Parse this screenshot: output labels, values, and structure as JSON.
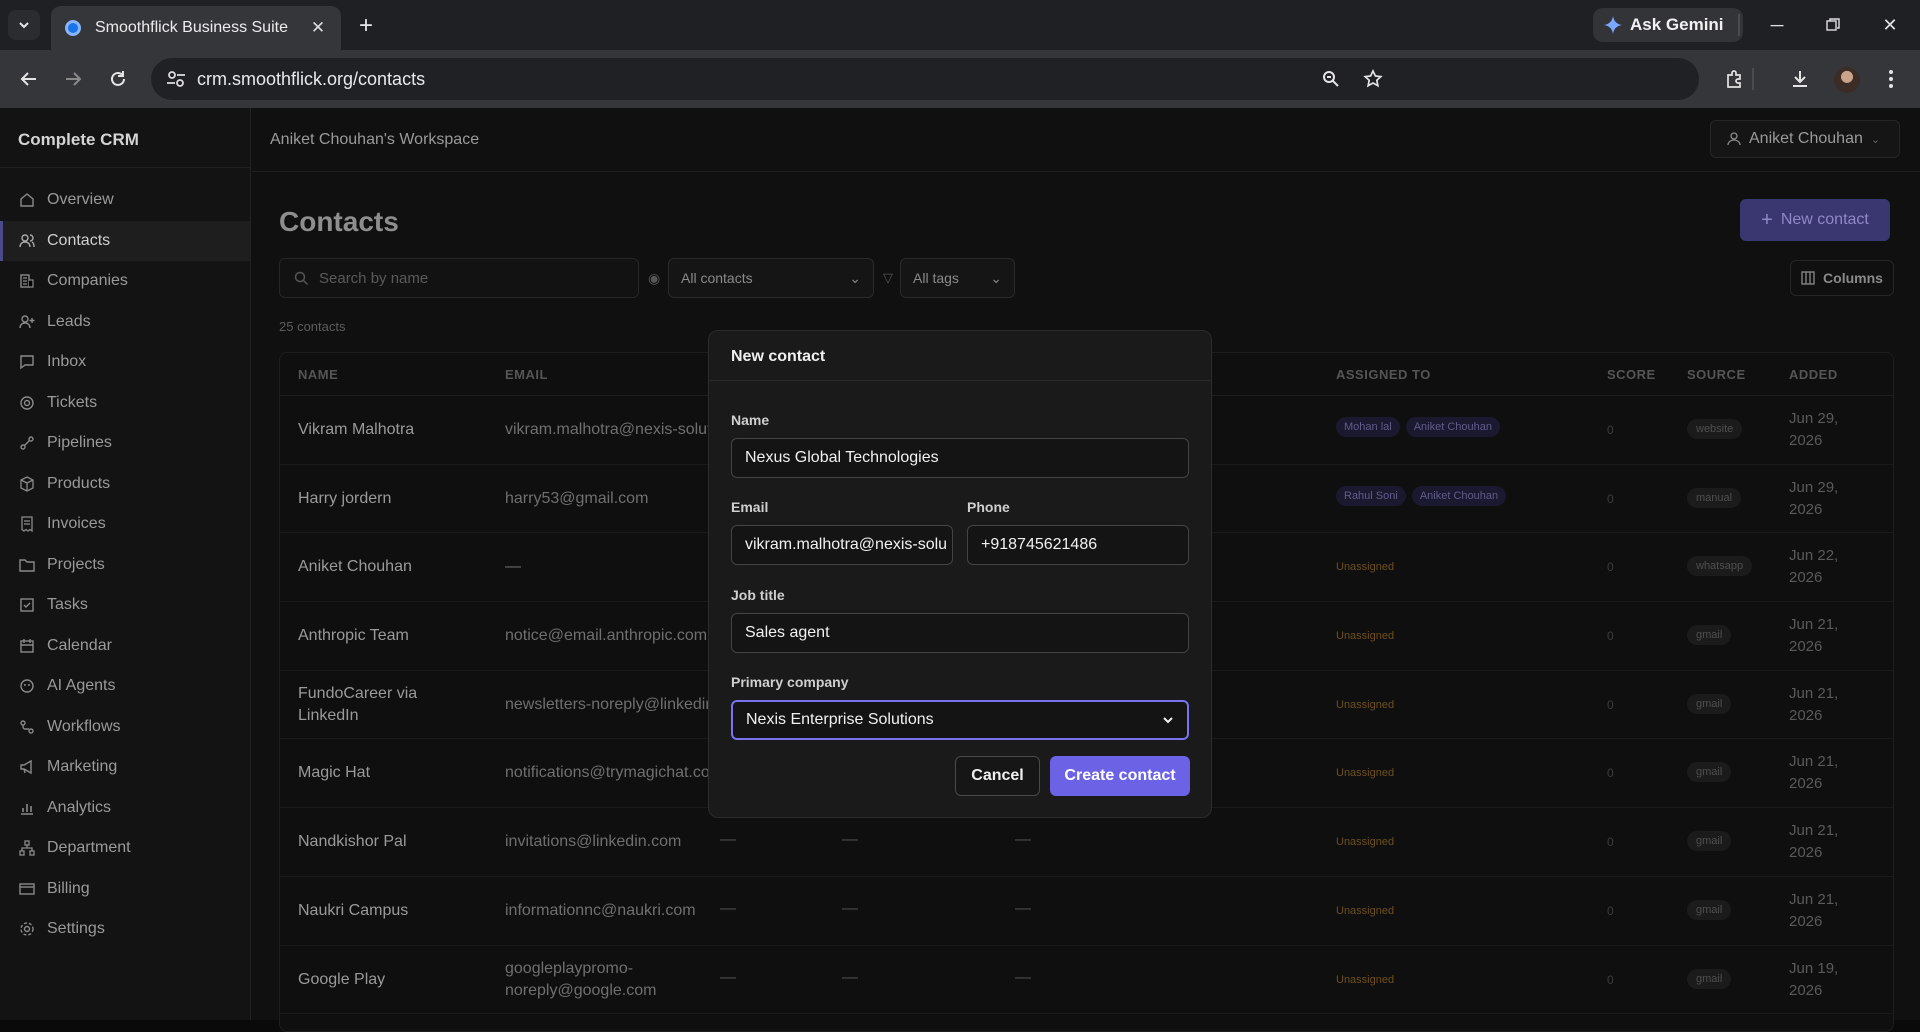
{
  "browser": {
    "tab_title": "Smoothflick Business Suite",
    "url": "crm.smoothflick.org/contacts",
    "gemini_label": "Ask Gemini"
  },
  "sidebar": {
    "brand": "Complete CRM",
    "items": [
      {
        "label": "Overview",
        "icon": "home-icon"
      },
      {
        "label": "Contacts",
        "icon": "users-icon",
        "active": true
      },
      {
        "label": "Companies",
        "icon": "building-icon"
      },
      {
        "label": "Leads",
        "icon": "user-plus-icon"
      },
      {
        "label": "Inbox",
        "icon": "message-icon"
      },
      {
        "label": "Tickets",
        "icon": "lifebuoy-icon"
      },
      {
        "label": "Pipelines",
        "icon": "pipeline-icon"
      },
      {
        "label": "Products",
        "icon": "package-icon"
      },
      {
        "label": "Invoices",
        "icon": "receipt-icon"
      },
      {
        "label": "Projects",
        "icon": "folder-icon"
      },
      {
        "label": "Tasks",
        "icon": "checkbox-icon"
      },
      {
        "label": "Calendar",
        "icon": "calendar-icon"
      },
      {
        "label": "AI Agents",
        "icon": "bot-icon"
      },
      {
        "label": "Workflows",
        "icon": "workflow-icon"
      },
      {
        "label": "Marketing",
        "icon": "megaphone-icon"
      },
      {
        "label": "Analytics",
        "icon": "bar-chart-icon"
      },
      {
        "label": "Department",
        "icon": "network-icon"
      },
      {
        "label": "Billing",
        "icon": "credit-card-icon"
      },
      {
        "label": "Settings",
        "icon": "gear-icon"
      }
    ]
  },
  "header": {
    "workspace": "Aniket Chouhan's Workspace",
    "user": "Aniket Chouhan"
  },
  "contacts": {
    "title": "Contacts",
    "new_button": "New contact",
    "search_placeholder": "Search by name",
    "filter_contacts": "All contacts",
    "filter_tags": "All tags",
    "columns_button": "Columns",
    "count": "25 contacts",
    "headers": [
      "NAME",
      "EMAIL",
      "ASSIGNED TO",
      "SCORE",
      "SOURCE",
      "ADDED"
    ],
    "rows": [
      {
        "name": "Vikram Malhotra",
        "email": "vikram.malhotra@nexis-solut",
        "assigned": [
          "Mohan lal",
          "Aniket Chouhan"
        ],
        "score": "0",
        "source": "website",
        "added": "Jun 29, 2026"
      },
      {
        "name": "Harry jordern",
        "email": "harry53@gmail.com",
        "assigned": [
          "Rahul Soni",
          "Aniket Chouhan"
        ],
        "score": "0",
        "source": "manual",
        "added": "Jun 29, 2026"
      },
      {
        "name": "Aniket Chouhan",
        "email": "—",
        "assigned_text": "Unassigned",
        "score": "0",
        "source": "whatsapp",
        "added": "Jun 22, 2026"
      },
      {
        "name": "Anthropic Team",
        "email": "notice@email.anthropic.com",
        "assigned_text": "Unassigned",
        "score": "0",
        "source": "gmail",
        "added": "Jun 21, 2026"
      },
      {
        "name": "FundoCareer via LinkedIn",
        "email": "newsletters-noreply@linkedin",
        "assigned_text": "Unassigned",
        "score": "0",
        "source": "gmail",
        "added": "Jun 21, 2026"
      },
      {
        "name": "Magic Hat",
        "email": "notifications@trymagichat.co",
        "assigned_text": "Unassigned",
        "score": "0",
        "source": "gmail",
        "added": "Jun 21, 2026"
      },
      {
        "name": "Nandkishor Pal",
        "email": "invitations@linkedin.com",
        "dash": "—",
        "assigned_text": "Unassigned",
        "score": "0",
        "source": "gmail",
        "added": "Jun 21, 2026"
      },
      {
        "name": "Naukri Campus",
        "email": "informationnc@naukri.com",
        "dash": "—",
        "assigned_text": "Unassigned",
        "score": "0",
        "source": "gmail",
        "added": "Jun 21, 2026"
      },
      {
        "name": "Google Play",
        "email": "googleplaypromo-noreply@google.com",
        "dash": "—",
        "assigned_text": "Unassigned",
        "score": "0",
        "source": "gmail",
        "added": "Jun 19, 2026"
      }
    ]
  },
  "modal": {
    "title": "New contact",
    "name_label": "Name",
    "name_value": "Nexus Global Technologies",
    "email_label": "Email",
    "email_value": "vikram.malhotra@nexis-solu",
    "phone_label": "Phone",
    "phone_value": "+918745621486",
    "job_label": "Job title",
    "job_value": "Sales agent",
    "company_label": "Primary company",
    "company_value": "Nexis Enterprise Solutions",
    "cancel": "Cancel",
    "create": "Create contact"
  },
  "colors": {
    "accent": "#6c62e6",
    "unassigned": "#b7791f"
  }
}
